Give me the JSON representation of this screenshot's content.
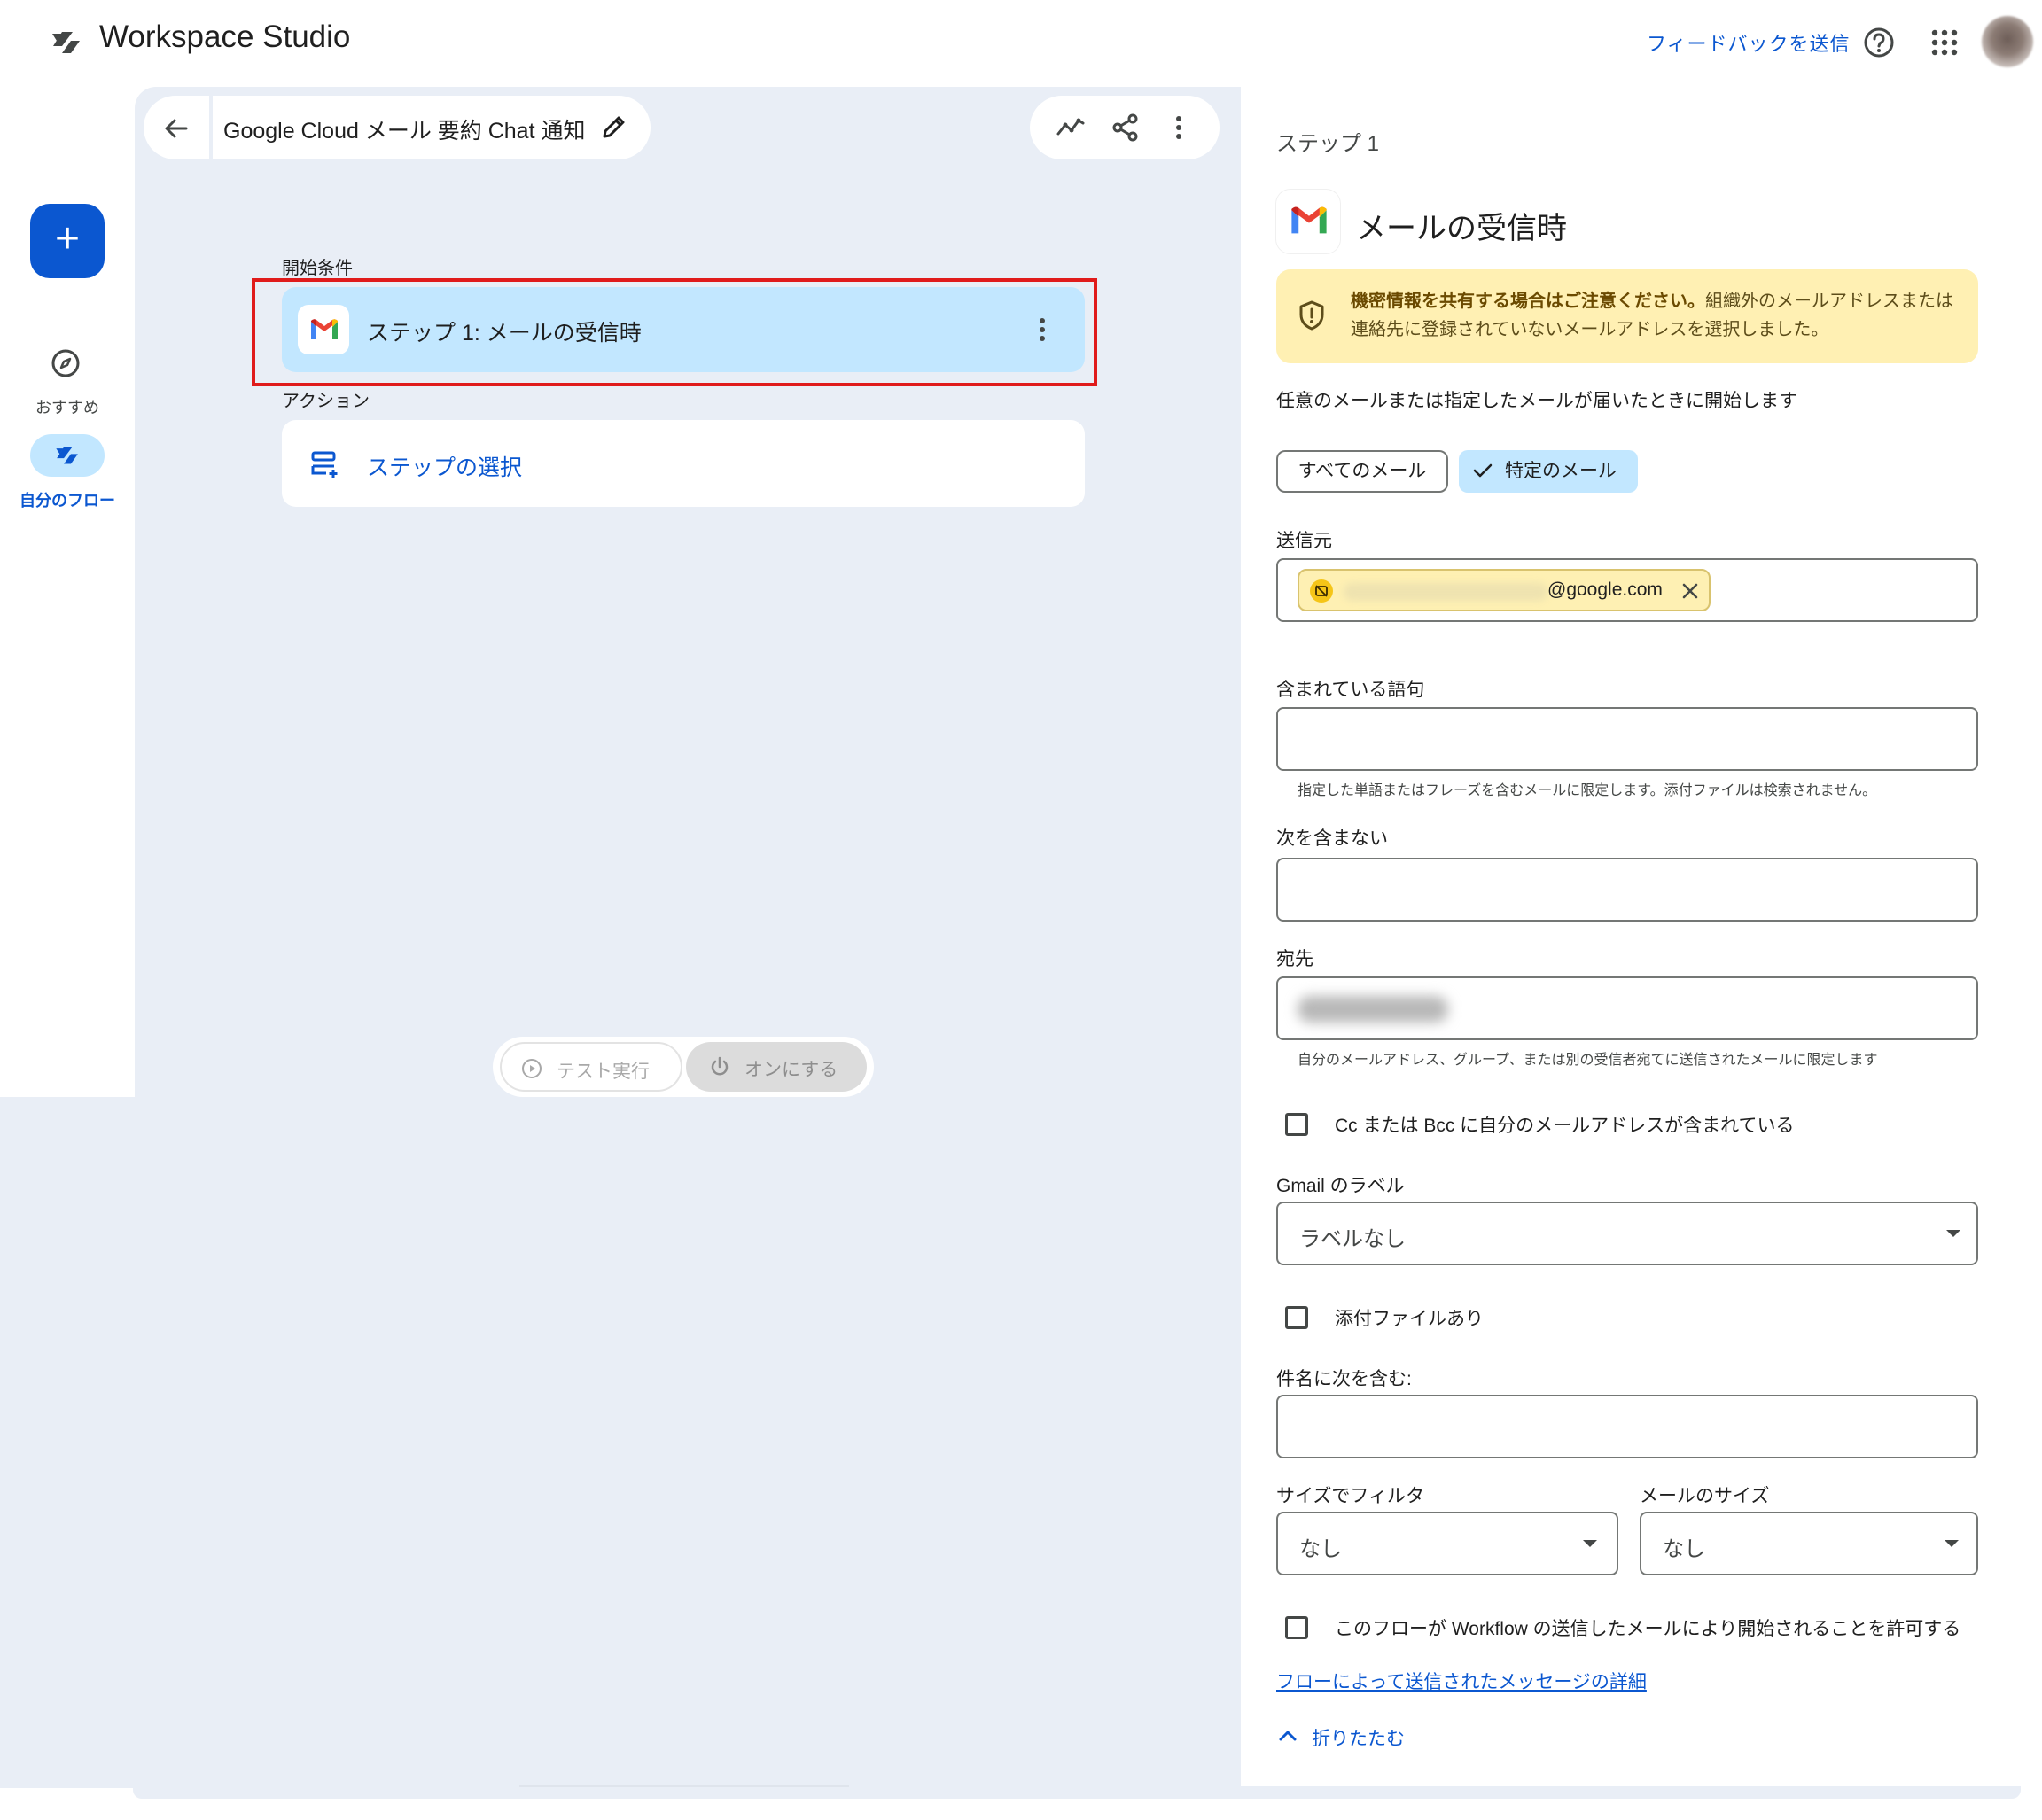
{
  "app": {
    "title": "Workspace Studio",
    "feedback": "フィードバックを送信",
    "icons": [
      "workspace-studio-logo-icon",
      "help-icon",
      "apps-grid-icon"
    ]
  },
  "nav": {
    "create_label": "+",
    "recommended_label": "おすすめ",
    "my_flows_label": "自分のフロー"
  },
  "flow": {
    "title": "Google Cloud メール 要約 Chat 通知",
    "start_section": "開始条件",
    "step1_label": "ステップ 1: メールの受信時",
    "action_section": "アクション",
    "select_step_label": "ステップの選択",
    "test_run": "テスト実行",
    "turn_on": "オンにする"
  },
  "panel": {
    "step_number": "ステップ 1",
    "title": "メールの受信時",
    "warning_bold": "機密情報を共有する場合はご注意ください。",
    "warning_text": "組織外のメールアドレスまたは連絡先に登録されていないメールアドレスを選択しました。",
    "description": "任意のメールまたは指定したメールが届いたときに開始します",
    "chip_all": "すべてのメール",
    "chip_specific": "特定のメール",
    "sender_label": "送信元",
    "sender_domain": "@google.com",
    "contains_label": "含まれている語句",
    "contains_value": "",
    "contains_hint": "指定した単語またはフレーズを含むメールに限定します。添付ファイルは検索されません。",
    "not_contains_label": "次を含まない",
    "not_contains_value": "",
    "to_label": "宛先",
    "to_hint": "自分のメールアドレス、グループ、または別の受信者宛てに送信されたメールに限定します",
    "cc_label": "Cc または Bcc に自分のメールアドレスが含まれている",
    "gmail_label_label": "Gmail のラベル",
    "gmail_label_value": "ラベルなし",
    "attachment_label": "添付ファイルあり",
    "subject_label": "件名に次を含む:",
    "subject_value": "",
    "size_filter_label": "サイズでフィルタ",
    "size_filter_value": "なし",
    "mail_size_label": "メールのサイズ",
    "mail_size_value": "なし",
    "allow_workflow_label": "このフローが Workflow の送信したメールにより開始されることを許可する",
    "details_link": "フローによって送信されたメッセージの詳細",
    "collapse_label": "折りたたむ"
  },
  "colors": {
    "accent": "#0b57d0",
    "selected_bg": "#c2e7ff",
    "canvas_bg": "#e9eef6",
    "warning_bg": "#fff0b3",
    "highlight_border": "#e01b1b"
  }
}
